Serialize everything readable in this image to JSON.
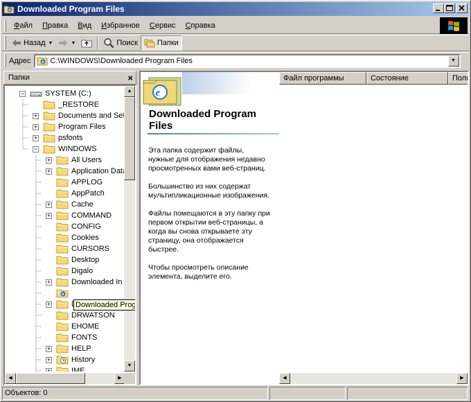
{
  "window": {
    "title": "Downloaded Program Files",
    "title_bar_color": "#0a246a"
  },
  "menu": {
    "items": [
      {
        "id": "file",
        "accel": "Ф",
        "rest": "айл"
      },
      {
        "id": "edit",
        "accel": "П",
        "rest": "равка"
      },
      {
        "id": "view",
        "accel": "В",
        "rest": "ид"
      },
      {
        "id": "favorites",
        "accel": "И",
        "rest": "збранное"
      },
      {
        "id": "tools",
        "accel": "С",
        "rest": "ервис"
      },
      {
        "id": "help",
        "accel": "С",
        "rest": "правка"
      }
    ]
  },
  "toolbar": {
    "back_label": "Назад",
    "search_label": "Поиск",
    "folders_label": "Папки"
  },
  "address": {
    "label": "Адрес",
    "value": "C:\\WINDOWS\\Downloaded Program Files"
  },
  "folders_pane": {
    "title": "Папки",
    "close_glyph": "×",
    "tree": [
      {
        "label": "SYSTEM (C:)",
        "level": 0,
        "expander": "minus",
        "icon": "drive-icon"
      },
      {
        "label": "_RESTORE",
        "level": 1,
        "expander": "none",
        "icon": "folder-icon"
      },
      {
        "label": "Documents and Set",
        "level": 1,
        "expander": "plus",
        "icon": "folder-icon"
      },
      {
        "label": "Program Files",
        "level": 1,
        "expander": "plus",
        "icon": "folder-icon"
      },
      {
        "label": "psfonts",
        "level": 1,
        "expander": "plus",
        "icon": "folder-icon"
      },
      {
        "label": "WINDOWS",
        "level": 1,
        "expander": "minus",
        "icon": "folder-icon"
      },
      {
        "label": "All Users",
        "level": 2,
        "expander": "plus",
        "icon": "folder-icon"
      },
      {
        "label": "Application Data",
        "level": 2,
        "expander": "plus",
        "icon": "folder-icon"
      },
      {
        "label": "APPLOG",
        "level": 2,
        "expander": "none",
        "icon": "folder-icon"
      },
      {
        "label": "AppPatch",
        "level": 2,
        "expander": "none",
        "icon": "folder-icon"
      },
      {
        "label": "Cache",
        "level": 2,
        "expander": "plus",
        "icon": "folder-icon"
      },
      {
        "label": "COMMAND",
        "level": 2,
        "expander": "plus",
        "icon": "folder-icon"
      },
      {
        "label": "CONFIG",
        "level": 2,
        "expander": "none",
        "icon": "folder-icon"
      },
      {
        "label": "Cookies",
        "level": 2,
        "expander": "none",
        "icon": "folder-icon"
      },
      {
        "label": "CURSORS",
        "level": 2,
        "expander": "none",
        "icon": "folder-icon"
      },
      {
        "label": "Desktop",
        "level": 2,
        "expander": "none",
        "icon": "folder-icon"
      },
      {
        "label": "Digalo",
        "level": 2,
        "expander": "none",
        "icon": "folder-icon"
      },
      {
        "label": "Downloaded In",
        "level": 2,
        "expander": "plus",
        "icon": "folder-icon"
      },
      {
        "label": "",
        "level": 2,
        "expander": "none",
        "icon": "ie-folder-icon",
        "selected": true
      },
      {
        "label": "Driver Cache",
        "level": 2,
        "expander": "plus",
        "icon": "folder-icon"
      },
      {
        "label": "DRWATSON",
        "level": 2,
        "expander": "none",
        "icon": "folder-icon"
      },
      {
        "label": "EHOME",
        "level": 2,
        "expander": "none",
        "icon": "folder-icon"
      },
      {
        "label": "FONTS",
        "level": 2,
        "expander": "none",
        "icon": "folder-icon"
      },
      {
        "label": "HELP",
        "level": 2,
        "expander": "plus",
        "icon": "folder-icon"
      },
      {
        "label": "History",
        "level": 2,
        "expander": "plus",
        "icon": "history-folder-icon"
      },
      {
        "label": "IME",
        "level": 2,
        "expander": "plus",
        "icon": "folder-icon"
      }
    ],
    "selected_full_label": "Downloaded Program Files"
  },
  "content": {
    "heading": "Downloaded Program Files",
    "paragraphs": [
      "Эта папка содержит файлы,\nнужные для отображения недавно\nпросмотренных вами веб-страниц.",
      "Большинство из них содержат\nмультипликационные изображения.",
      "Файлы помещаются в эту папку при\nпервом открытии веб-страницы, а\nкогда вы снова открываете эту\nстраницу, она отображается\nбыстрее.",
      "Чтобы просмотреть описание\nэлемента, выделите его."
    ],
    "columns": [
      "Файл программы",
      "Состояние",
      "Полн"
    ]
  },
  "status": {
    "objects": "Объектов: 0"
  }
}
